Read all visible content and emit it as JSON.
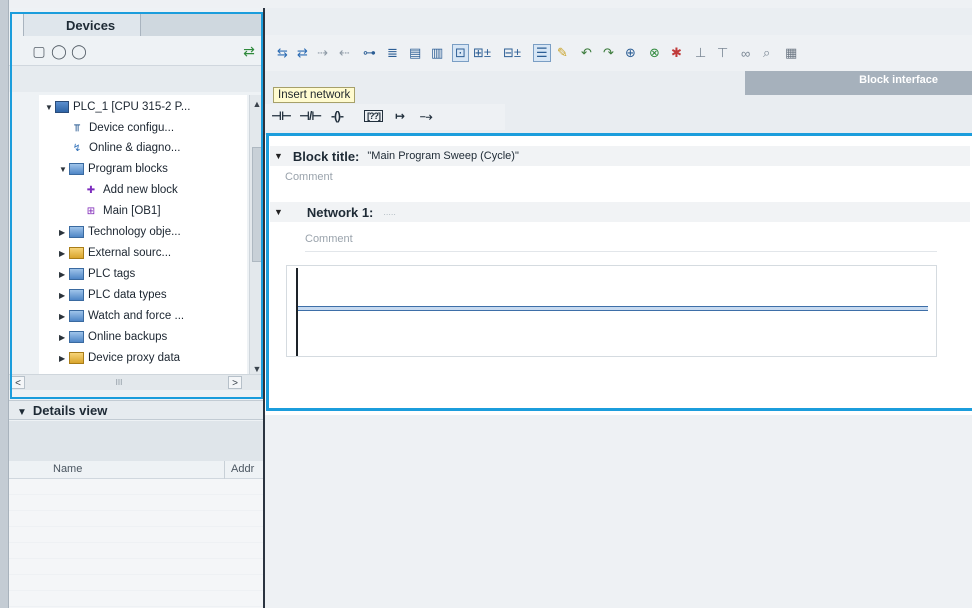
{
  "devices_pane": {
    "tab_title": "Devices",
    "tree": [
      {
        "label": "PLC_1 [CPU 315-2 P...",
        "icon": "plc-icon",
        "expanded": true
      },
      {
        "label": "Device configu...",
        "icon": "device-config-icon"
      },
      {
        "label": "Online & diagno...",
        "icon": "diagnostics-icon"
      },
      {
        "label": "Program blocks",
        "icon": "folder-icon",
        "expanded": true
      },
      {
        "label": "Add new block",
        "icon": "add-block-icon"
      },
      {
        "label": "Main [OB1]",
        "icon": "ob-block-icon"
      },
      {
        "label": "Technology obje...",
        "icon": "folder-icon",
        "expanded": false
      },
      {
        "label": "External sourc...",
        "icon": "folder-icon",
        "expanded": false
      },
      {
        "label": "PLC tags",
        "icon": "folder-icon",
        "expanded": false
      },
      {
        "label": "PLC data types",
        "icon": "folder-icon",
        "expanded": false
      },
      {
        "label": "Watch and force ...",
        "icon": "folder-icon",
        "expanded": false
      },
      {
        "label": "Online backups",
        "icon": "folder-icon",
        "expanded": false
      },
      {
        "label": "Device proxy data",
        "icon": "folder-icon",
        "expanded": false
      }
    ],
    "hscroll_thumb": "III"
  },
  "details_view": {
    "title": "Details view",
    "columns": [
      "Name",
      "Addr"
    ]
  },
  "editor": {
    "tooltip": "Insert network",
    "block_interface_label": "Block interface",
    "ladder_tools": [
      "⊣⊢",
      "⊣/⊢",
      "-()-",
      "[??]",
      "↦",
      "⤍"
    ],
    "block_title_label": "Block title:",
    "block_title_value": "\"Main Program Sweep (Cycle)\"",
    "block_comment": "Comment",
    "network_label": "Network 1:",
    "network_dots": ".....",
    "network_comment": "Comment"
  },
  "colors": {
    "highlight": "#1b9ddc",
    "rung_fill": "#c7daf0",
    "tooltip_bg": "#fffbd0"
  }
}
